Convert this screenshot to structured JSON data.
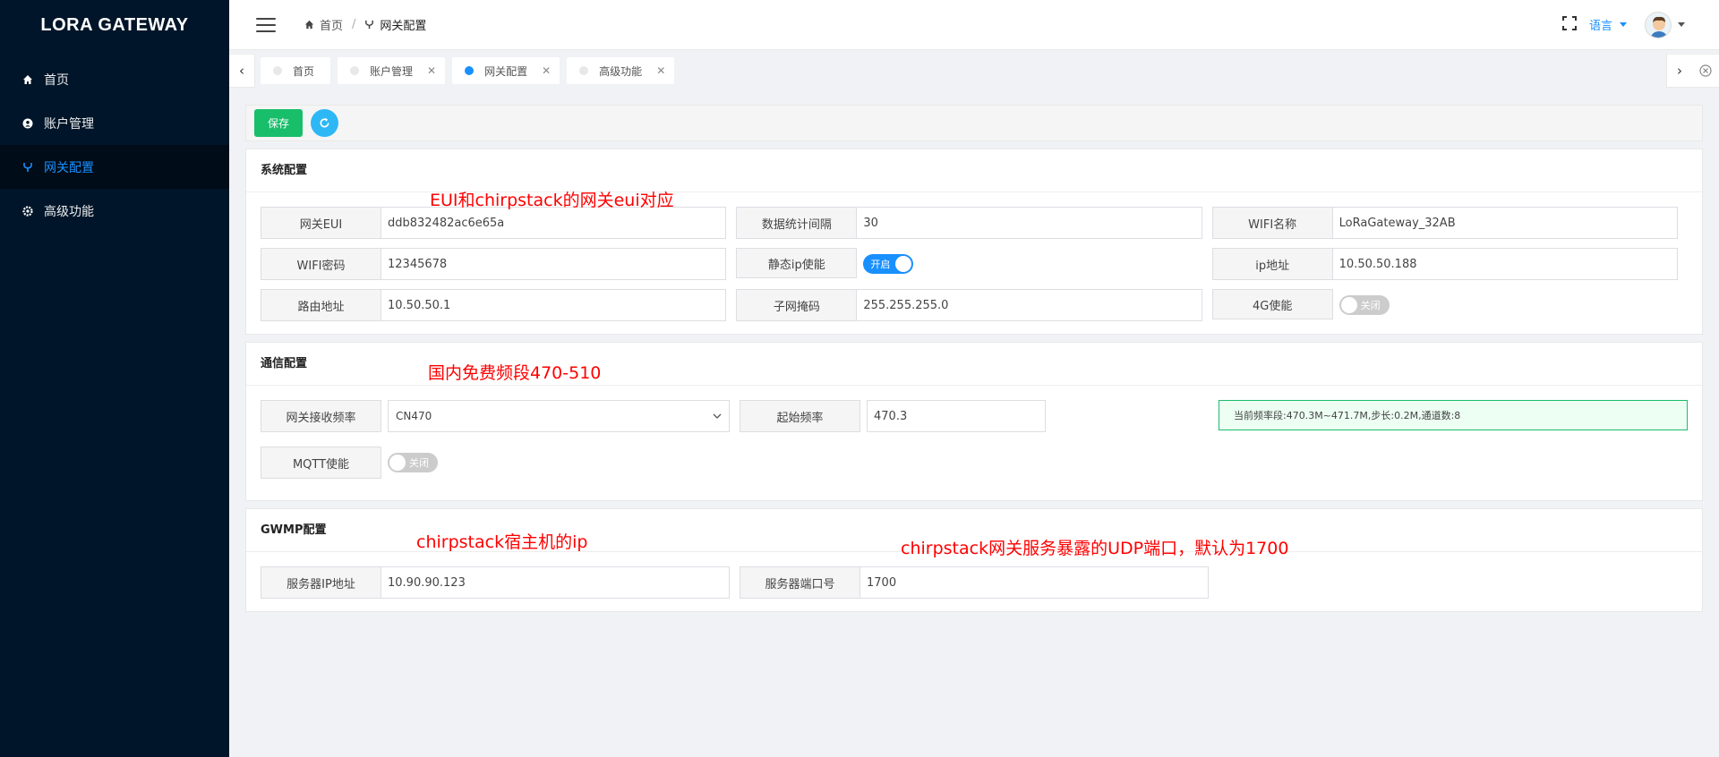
{
  "app": {
    "title": "LORA GATEWAY"
  },
  "sidebar": {
    "items": [
      {
        "label": "首页",
        "icon": "home-icon"
      },
      {
        "label": "账户管理",
        "icon": "user-icon"
      },
      {
        "label": "网关配置",
        "icon": "gateway-icon",
        "active": true
      },
      {
        "label": "高级功能",
        "icon": "settings-icon"
      }
    ]
  },
  "header": {
    "breadcrumb": [
      {
        "label": "首页"
      },
      {
        "label": "网关配置"
      }
    ],
    "lang_label": "语言"
  },
  "tabs": [
    {
      "label": "首页"
    },
    {
      "label": "账户管理"
    },
    {
      "label": "网关配置",
      "active": true
    },
    {
      "label": "高级功能"
    }
  ],
  "toolbar": {
    "save_label": "保存"
  },
  "colors": {
    "sidebar_bg": "#001529",
    "accent": "#1890ff",
    "save_green": "#19be6b",
    "annotation_red": "#ff0000"
  },
  "sections": {
    "system": {
      "title": "系统配置",
      "annotation": "EUI和chirpstack的网关eui对应",
      "fields": {
        "gateway_eui": {
          "label": "网关EUI",
          "value": "ddb832482ac6e65a"
        },
        "stats_interval": {
          "label": "数据统计间隔",
          "value": "30"
        },
        "wifi_name": {
          "label": "WIFI名称",
          "value": "LoRaGateway_32AB"
        },
        "wifi_password": {
          "label": "WIFI密码",
          "value": "12345678"
        },
        "static_ip": {
          "label": "静态ip使能",
          "toggle": "开启",
          "on": true
        },
        "ip_address": {
          "label": "ip地址",
          "value": "10.50.50.188"
        },
        "router": {
          "label": "路由地址",
          "value": "10.50.50.1"
        },
        "subnet": {
          "label": "子网掩码",
          "value": "255.255.255.0"
        },
        "lte": {
          "label": "4G使能",
          "toggle": "关闭",
          "on": false
        }
      }
    },
    "comm": {
      "title": "通信配置",
      "annotation": "国内免费频段470-510",
      "fields": {
        "rx_freq": {
          "label": "网关接收频率",
          "value": "CN470"
        },
        "start_freq": {
          "label": "起始频率",
          "value": "470.3"
        },
        "info": "当前频率段:470.3M~471.7M,步长:0.2M,通道数:8",
        "mqtt": {
          "label": "MQTT使能",
          "toggle": "关闭",
          "on": false
        }
      }
    },
    "gwmp": {
      "title": "GWMP配置",
      "annotation_ip": "chirpstack宿主机的ip",
      "annotation_port": "chirpstack网关服务暴露的UDP端口，默认为1700",
      "fields": {
        "server_ip": {
          "label": "服务器IP地址",
          "value": "10.90.90.123"
        },
        "server_port": {
          "label": "服务器端口号",
          "value": "1700"
        }
      }
    }
  }
}
